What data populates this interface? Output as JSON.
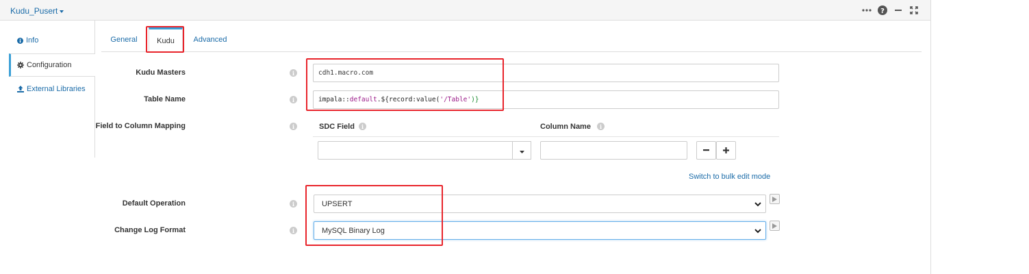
{
  "stage": {
    "title": "Kudu_Pusert"
  },
  "top_icons": [
    "more-icon",
    "help-icon",
    "minimize-icon",
    "maximize-icon"
  ],
  "sidebar": {
    "items": [
      {
        "label": "Info",
        "icon": "info-icon"
      },
      {
        "label": "Configuration",
        "icon": "gear-icon"
      },
      {
        "label": "External Libraries",
        "icon": "upload-icon"
      }
    ],
    "active": "Configuration"
  },
  "tabs": [
    {
      "label": "General"
    },
    {
      "label": "Kudu"
    },
    {
      "label": "Advanced"
    }
  ],
  "active_tab": "Kudu",
  "form": {
    "kudu_masters": {
      "label": "Kudu Masters",
      "value": "cdh1.macro.com"
    },
    "table_name": {
      "label": "Table Name",
      "value_parts": {
        "p1": "impala::",
        "p2": "default",
        "p3": ".${",
        "p4": "record:value(",
        "p5": "'/Table'",
        "p6": ")}"
      }
    },
    "mapping": {
      "label": "Field to Column Mapping",
      "sdc_field_header": "SDC Field",
      "column_name_header": "Column Name",
      "sdc_field_value": "",
      "column_name_value": "",
      "bulk_edit_link": "Switch to bulk edit mode"
    },
    "default_operation": {
      "label": "Default Operation",
      "value": "UPSERT"
    },
    "change_log_format": {
      "label": "Change Log Format",
      "value": "MySQL Binary Log"
    }
  },
  "colors": {
    "highlight": "#e8232a",
    "accent": "#3a9fd6",
    "link": "#1a6ba8"
  }
}
